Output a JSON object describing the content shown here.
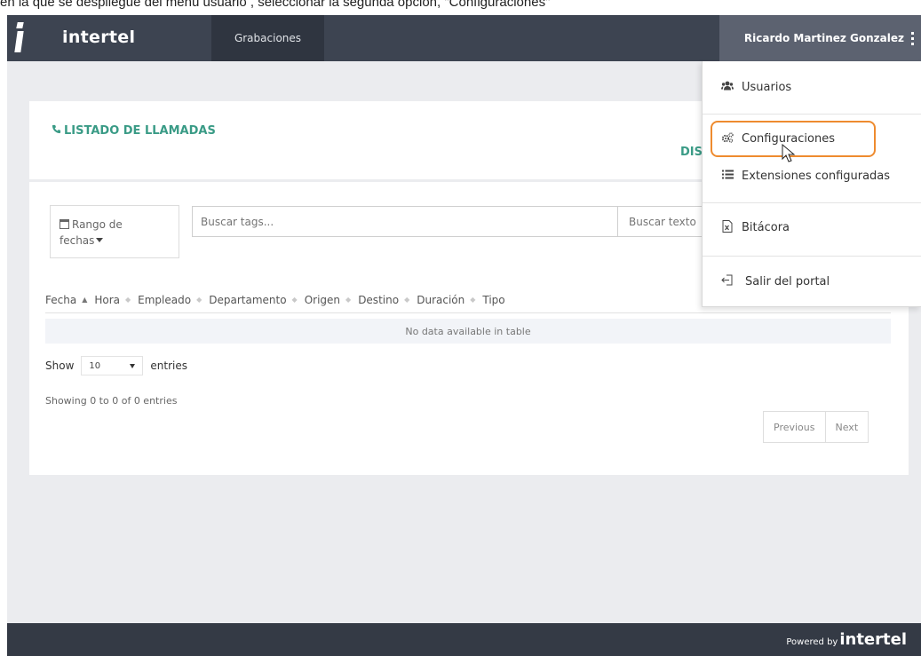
{
  "caption": "en la que se despliegue del menú usuario , seleccionar la segunda opción, \"Configuraciones\"",
  "header": {
    "brand": "intertel",
    "nav_tab": "Grabaciones",
    "user_name": "Ricardo Martinez Gonzalez"
  },
  "card": {
    "title": "LISTADO DE LLAMADAS",
    "subtitle_partial": "DIS"
  },
  "filters": {
    "date_label_line1": "Rango de",
    "date_label_line2": "fechas",
    "tags_placeholder": "Buscar tags...",
    "text_placeholder": "Buscar texto"
  },
  "table": {
    "columns": [
      "Fecha",
      "Hora",
      "Empleado",
      "Departamento",
      "Origen",
      "Destino",
      "Duración",
      "Tipo"
    ],
    "empty_message": "No data available in table"
  },
  "length": {
    "show_label": "Show",
    "value": "10",
    "entries_label": "entries"
  },
  "info": "Showing 0 to 0 of 0 entries",
  "pager": {
    "previous": "Previous",
    "next": "Next"
  },
  "menu": {
    "usuarios": "Usuarios",
    "configuraciones": "Configuraciones",
    "extensiones": "Extensiones configuradas",
    "bitacora": "Bitácora",
    "salir": "Salir del portal"
  },
  "footer": {
    "powered_by": "Powered by",
    "brand": "intertel"
  },
  "colors": {
    "accent": "#3a9b86",
    "highlight": "#ee8b2f",
    "topbar": "#3d4451"
  }
}
